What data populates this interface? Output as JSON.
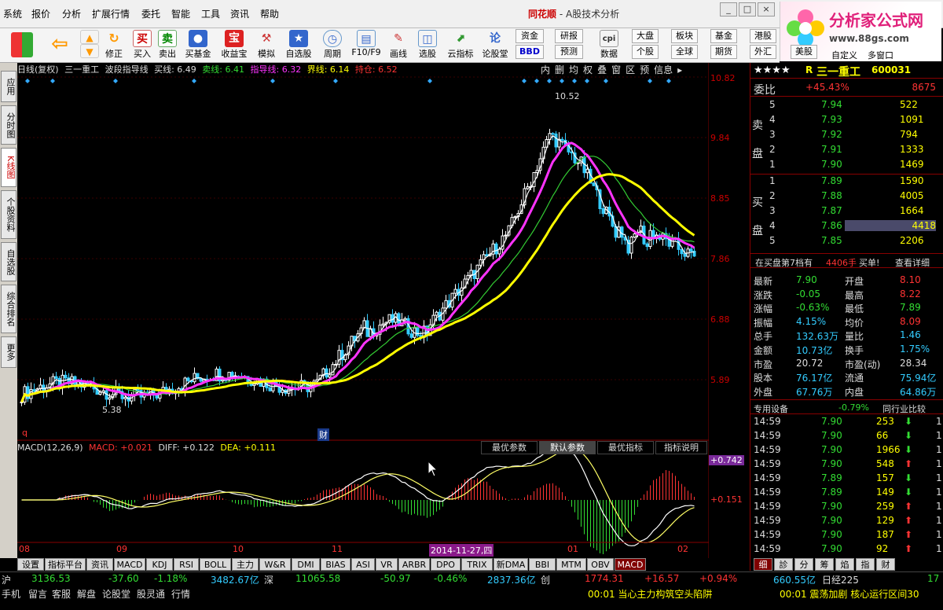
{
  "menu": [
    "系统",
    "报价",
    "分析",
    "扩展行情",
    "委托",
    "智能",
    "工具",
    "资讯",
    "帮助"
  ],
  "app_title": {
    "brand": "同花顺",
    "sep": " - ",
    "sub": "A股技术分析"
  },
  "logo": {
    "text": "分析家公式网",
    "url_text": "www.88gs.com"
  },
  "toolbar": {
    "buttons": [
      "买入",
      "卖出",
      "买基金",
      "收益宝",
      "模拟",
      "自选股",
      "周期",
      "F10/F9",
      "画线",
      "选股",
      "云指标",
      "论股堂",
      "数据",
      "自定义",
      "多窗口"
    ],
    "nav": [
      "修正"
    ],
    "small": [
      "资金",
      "研报",
      "BBD",
      "预测",
      "大盘",
      "板块",
      "基金",
      "港股",
      "个股",
      "全球",
      "期货",
      "外汇",
      "美股"
    ],
    "cpi": "cpi"
  },
  "lefttabs": [
    "应用",
    "分时图",
    "K线图",
    "个股资料",
    "自选股",
    "综合排名",
    "更多"
  ],
  "chart_header": {
    "period": "日线(复权)",
    "name": "三一重工",
    "indicator": "波段指导线",
    "buy_line": "买线: 6.49",
    "sell_line": "卖线: 6.41",
    "guide_line": "指导线: 6.32",
    "boundary": "界线: 6.14",
    "position": "持仓: 6.52",
    "toolbar": [
      "内",
      "删",
      "均",
      "权",
      "叠",
      "窗",
      "区",
      "预",
      "信息",
      "▸"
    ]
  },
  "price_axis": [
    "10.82",
    "9.84",
    "8.85",
    "7.86",
    "6.88",
    "5.89"
  ],
  "annotations": {
    "high": "10.52",
    "low": "5.38",
    "cai": "财",
    "q": "q"
  },
  "macd_header": {
    "name": "MACD(12,26,9)",
    "macd": "MACD: +0.021",
    "diff": "DIFF: +0.122",
    "dea": "DEA: +0.111"
  },
  "macd_buttons": [
    "最优参数",
    "默认参数",
    "最优指标",
    "指标说明"
  ],
  "macd_axis": {
    "top": "+0.742",
    "mid": "+0.151"
  },
  "x_axis": {
    "labels": [
      "08",
      "09",
      "10",
      "11",
      "01",
      "02"
    ],
    "cursor_date": "2014-11-27,四"
  },
  "bottom_tabs": [
    "设置",
    "指标平台",
    "资讯",
    "MACD",
    "KDJ",
    "RSI",
    "BOLL",
    "主力",
    "W&R",
    "DMI",
    "BIAS",
    "ASI",
    "VR",
    "ARBR",
    "DPO",
    "TRIX",
    "新DMA",
    "BBI",
    "MTM",
    "OBV",
    "MACD"
  ],
  "quote": {
    "stars": "★★★★",
    "r": "R",
    "name": "三一重工",
    "code": "600031",
    "ratio_label": "委比",
    "ratio": "+45.43%",
    "ratio_vol": "8675",
    "sell_label": "卖盘",
    "buy_label": "买盘",
    "sells": [
      [
        "5",
        "7.94",
        "522"
      ],
      [
        "4",
        "7.93",
        "1091"
      ],
      [
        "3",
        "7.92",
        "794"
      ],
      [
        "2",
        "7.91",
        "1333"
      ],
      [
        "1",
        "7.90",
        "1469"
      ]
    ],
    "buys": [
      [
        "1",
        "7.89",
        "1590"
      ],
      [
        "2",
        "7.88",
        "4005"
      ],
      [
        "3",
        "7.87",
        "1664"
      ],
      [
        "4",
        "7.86",
        "4418"
      ],
      [
        "5",
        "7.85",
        "2206"
      ]
    ],
    "notice": "在买盘第7档有",
    "notice_vol": "4406手",
    "notice_action": "买单!",
    "notice_link": "查看详细",
    "stats": [
      [
        "最新",
        "7.90",
        "开盘",
        "8.10"
      ],
      [
        "涨跌",
        "-0.05",
        "最高",
        "8.22"
      ],
      [
        "涨幅",
        "-0.63%",
        "最低",
        "7.89"
      ],
      [
        "振幅",
        "4.15%",
        "均价",
        "8.09"
      ],
      [
        "总手",
        "132.63万",
        "量比",
        "1.46"
      ],
      [
        "金额",
        "10.73亿",
        "换手",
        "1.75%"
      ],
      [
        "市盈",
        "20.72",
        "市盈(动)",
        "28.34"
      ],
      [
        "股本",
        "76.17亿",
        "流通",
        "75.94亿"
      ],
      [
        "外盘",
        "67.76万",
        "内盘",
        "64.86万"
      ]
    ],
    "industry": "专用设备",
    "industry_chg": "-0.79%",
    "industry_link": "同行业比较",
    "ticks": [
      [
        "14:59",
        "7.90",
        "253",
        "down"
      ],
      [
        "14:59",
        "7.90",
        "66",
        "down"
      ],
      [
        "14:59",
        "7.90",
        "1966",
        "down"
      ],
      [
        "14:59",
        "7.90",
        "548",
        "up"
      ],
      [
        "14:59",
        "7.89",
        "157",
        "down"
      ],
      [
        "14:59",
        "7.89",
        "149",
        "down"
      ],
      [
        "14:59",
        "7.90",
        "259",
        "up"
      ],
      [
        "14:59",
        "7.90",
        "129",
        "up"
      ],
      [
        "14:59",
        "7.90",
        "187",
        "up"
      ],
      [
        "14:59",
        "7.90",
        "92",
        "up"
      ]
    ],
    "tick_tail": "1",
    "bottom_tabs": [
      "细",
      "診",
      "分",
      "筹",
      "焰",
      "指",
      "财"
    ]
  },
  "status1": {
    "sh_label": "沪",
    "sh_index": "3136.53",
    "sh_chg": "-37.60",
    "sh_pct": "-1.18%",
    "sh_amt": "3482.67亿",
    "sz_label": "深",
    "sz_index": "11065.58",
    "sz_chg": "-50.97",
    "sz_pct": "-0.46%",
    "sz_amt": "2837.36亿",
    "cy_label": "创",
    "cy_index": "1774.31",
    "cy_chg": "+16.57",
    "cy_pct": "+0.94%",
    "cy_amt": "660.55亿",
    "extra": "日经225",
    "extra_val": "17"
  },
  "status2": {
    "items": [
      "手机",
      "留言",
      "客服",
      "解盘",
      "论股堂",
      "股灵通",
      "行情"
    ],
    "news1": "00:01 当心主力构筑空头陷阱",
    "news2": "00:01 震荡加剧 核心运行区间30"
  },
  "colors": {
    "up": "#ff3333",
    "down": "#33dd33",
    "yellow": "#ffff00",
    "magenta": "#ff33ff",
    "green_ma": "#33cc33"
  }
}
